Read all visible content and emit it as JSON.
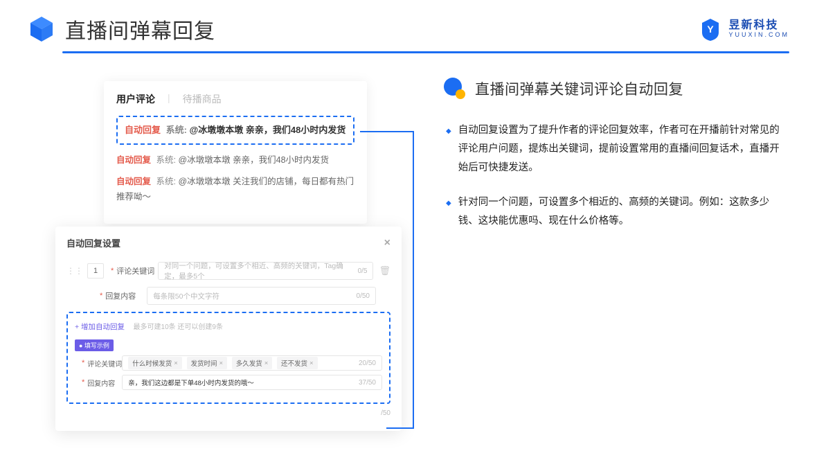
{
  "header": {
    "title": "直播间弹幕回复",
    "logo_cn": "昱新科技",
    "logo_en": "YUUXIN.COM"
  },
  "comment_panel": {
    "tabs": {
      "active": "用户评论",
      "inactive": "待播商品"
    },
    "highlighted": {
      "tag": "自动回复",
      "sys_prefix": "系统:",
      "text": "@冰墩墩本墩 亲亲，我们48小时内发货"
    },
    "rows": [
      {
        "tag": "自动回复",
        "sys_prefix": "系统:",
        "text": "@冰墩墩本墩 亲亲，我们48小时内发货"
      },
      {
        "tag": "自动回复",
        "sys_prefix": "系统:",
        "text": "@冰墩墩本墩 关注我们的店铺，每日都有热门推荐呦～"
      }
    ]
  },
  "settings": {
    "title": "自动回复设置",
    "close": "×",
    "index": "1",
    "line1": {
      "label": "评论关键词",
      "placeholder": "对同一个问题，可设置多个相近、高频的关键词，Tag确定，最多5个",
      "count": "0/5"
    },
    "line2": {
      "label": "回复内容",
      "placeholder": "每条限50个中文字符",
      "count": "0/50"
    },
    "add_link": "+ 增加自动回复",
    "add_hint": "最多可建10条 还可以创建9条",
    "example_badge": "● 填写示例",
    "example_kw": {
      "label": "评论关键词",
      "tags": [
        "什么时候发货",
        "发货时间",
        "多久发货",
        "还不发货"
      ],
      "count": "20/50"
    },
    "example_reply": {
      "label": "回复内容",
      "value": "亲，我们这边都是下单48小时内发货的哦～",
      "count": "37/50"
    },
    "bottom_count": "/50"
  },
  "right": {
    "section_title": "直播间弹幕关键词评论自动回复",
    "bullets": [
      "自动回复设置为了提升作者的评论回复效率，作者可在开播前针对常见的评论用户问题，提炼出关键词，提前设置常用的直播间回复话术，直播开始后可快捷发送。",
      "针对同一个问题，可设置多个相近的、高频的关键词。例如：这款多少钱、这块能优惠吗、现在什么价格等。"
    ]
  }
}
